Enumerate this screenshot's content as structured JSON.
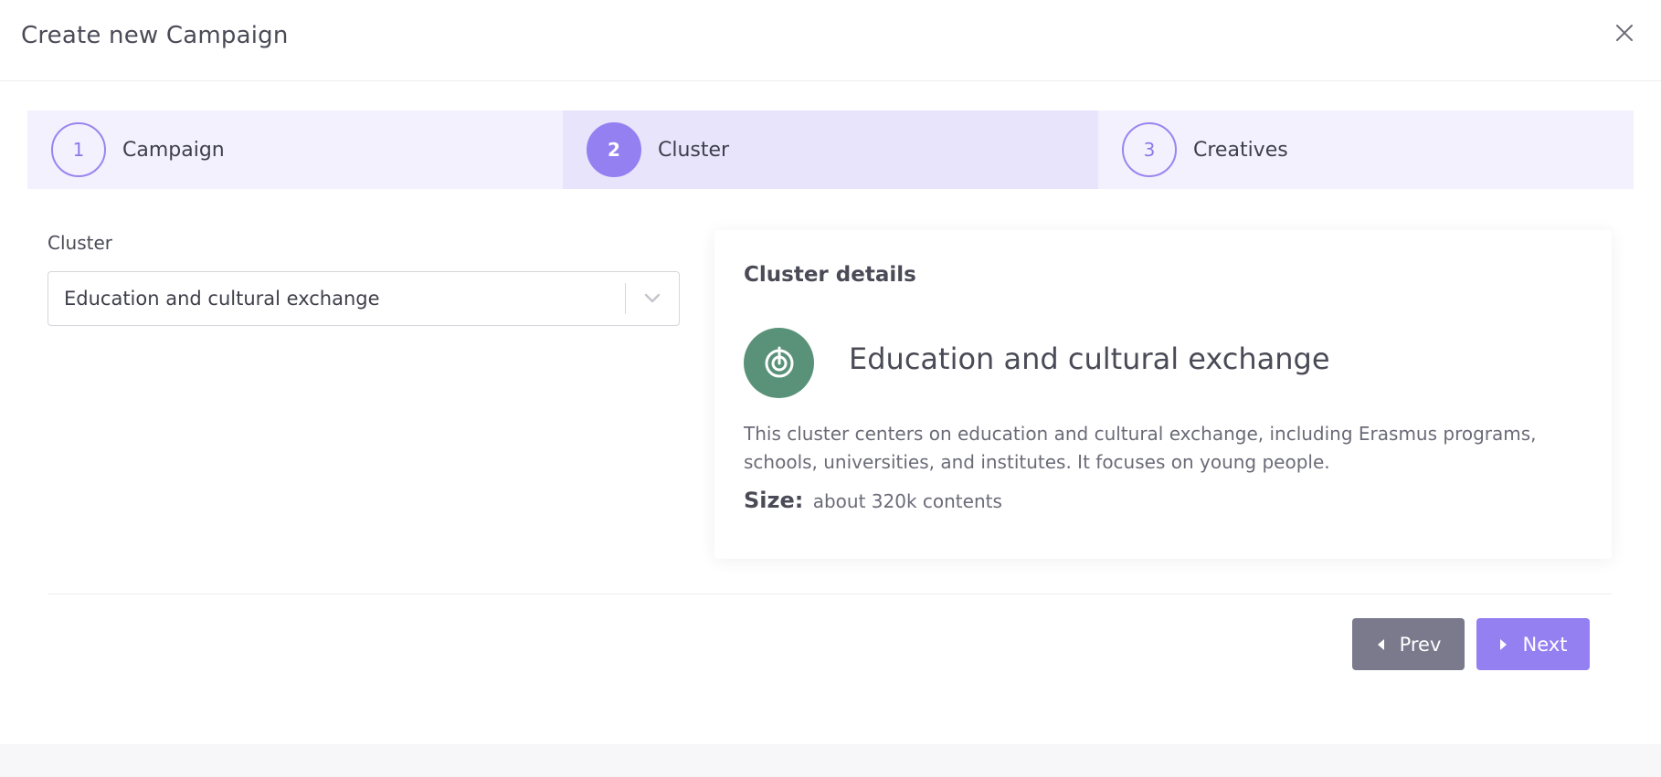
{
  "modal": {
    "title": "Create new Campaign",
    "close_icon": "close-icon"
  },
  "stepper": {
    "active_index": 1,
    "steps": [
      {
        "number": "1",
        "label": "Campaign"
      },
      {
        "number": "2",
        "label": "Cluster"
      },
      {
        "number": "3",
        "label": "Creatives"
      }
    ]
  },
  "form": {
    "cluster_label": "Cluster",
    "cluster_value": "Education and cultural exchange",
    "dropdown_icon": "chevron-down-icon"
  },
  "details": {
    "heading": "Cluster details",
    "icon": "cluster-target-icon",
    "icon_color": "#5a9279",
    "name": "Education and cultural exchange",
    "description": "This cluster centers on education and cultural exchange, including Erasmus programs, schools, universities, and institutes. It focuses on young people.",
    "size_label": "Size:",
    "size_value": "about 320k contents"
  },
  "footer": {
    "prev_label": "Prev",
    "next_label": "Next"
  },
  "colors": {
    "accent": "#9580f2",
    "step_bg": "#f3f1fe",
    "step_active_bg": "#e8e4fc",
    "prev_button": "#7a7a8c"
  }
}
